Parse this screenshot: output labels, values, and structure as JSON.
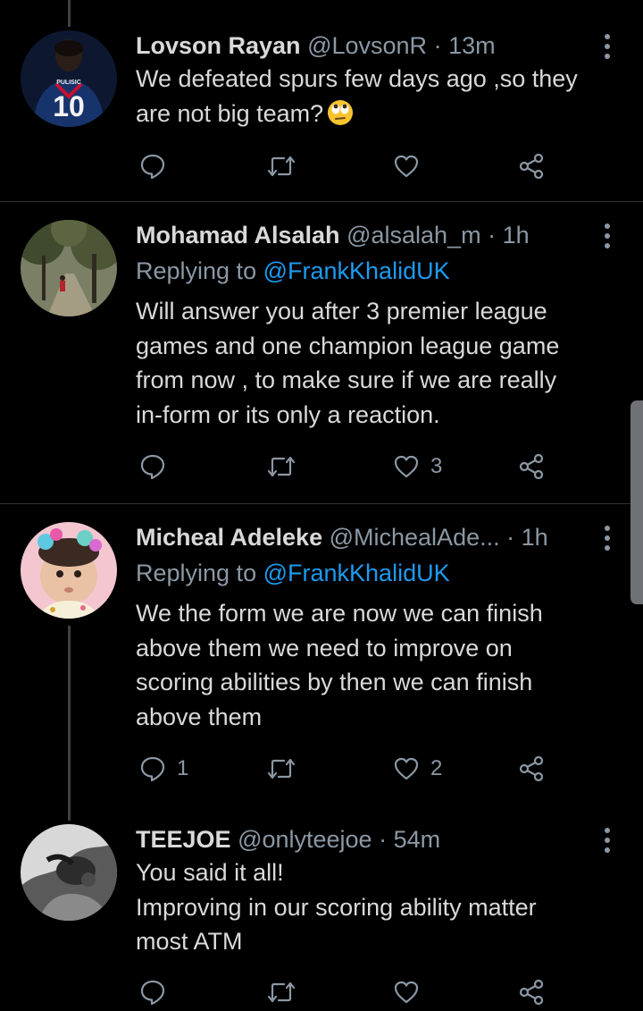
{
  "colors": {
    "background": "#000000",
    "text": "#d9d9d9",
    "secondary": "#8b98a5",
    "link": "#1d9bf0",
    "divider": "#2f3336"
  },
  "tweets": [
    {
      "name": "Lovson Rayan",
      "handle": "@LovsonR",
      "dot": "·",
      "time": "13m",
      "lines": [
        "We defeated spurs few days ago ,so they",
        "are not big team?"
      ],
      "emoji": "face-with-rolling-eyes",
      "avatar_text": {
        "name": "PULISIC",
        "number": "10"
      },
      "counts": {
        "reply": "",
        "retweet": "",
        "like": ""
      }
    },
    {
      "name": "Mohamad Alsalah",
      "handle": "@alsalah_m",
      "dot": "·",
      "time": "1h",
      "reply_prefix": "Replying to",
      "reply_mention": "@FrankKhalidUK",
      "lines": [
        "Will answer you after 3 premier league",
        "games and one champion league game",
        "from now , to make sure if we are really",
        "in-form or its only a reaction."
      ],
      "counts": {
        "reply": "",
        "retweet": "",
        "like": "3"
      }
    },
    {
      "name": "Micheal Adeleke",
      "handle": "@MichealAde...",
      "dot": "·",
      "time": "1h",
      "reply_prefix": "Replying to",
      "reply_mention": "@FrankKhalidUK",
      "lines": [
        "We the form we are now we can finish",
        "above them we need to improve on",
        "scoring abilities by then we can finish",
        "above them"
      ],
      "counts": {
        "reply": "1",
        "retweet": "",
        "like": "2"
      }
    },
    {
      "name": "TEEJOE",
      "handle": "@onlyteejoe",
      "dot": "·",
      "time": "54m",
      "lines": [
        "You said it all!",
        "Improving in our scoring ability matter",
        "most ATM"
      ],
      "counts": {
        "reply": "",
        "retweet": "",
        "like": ""
      }
    }
  ]
}
